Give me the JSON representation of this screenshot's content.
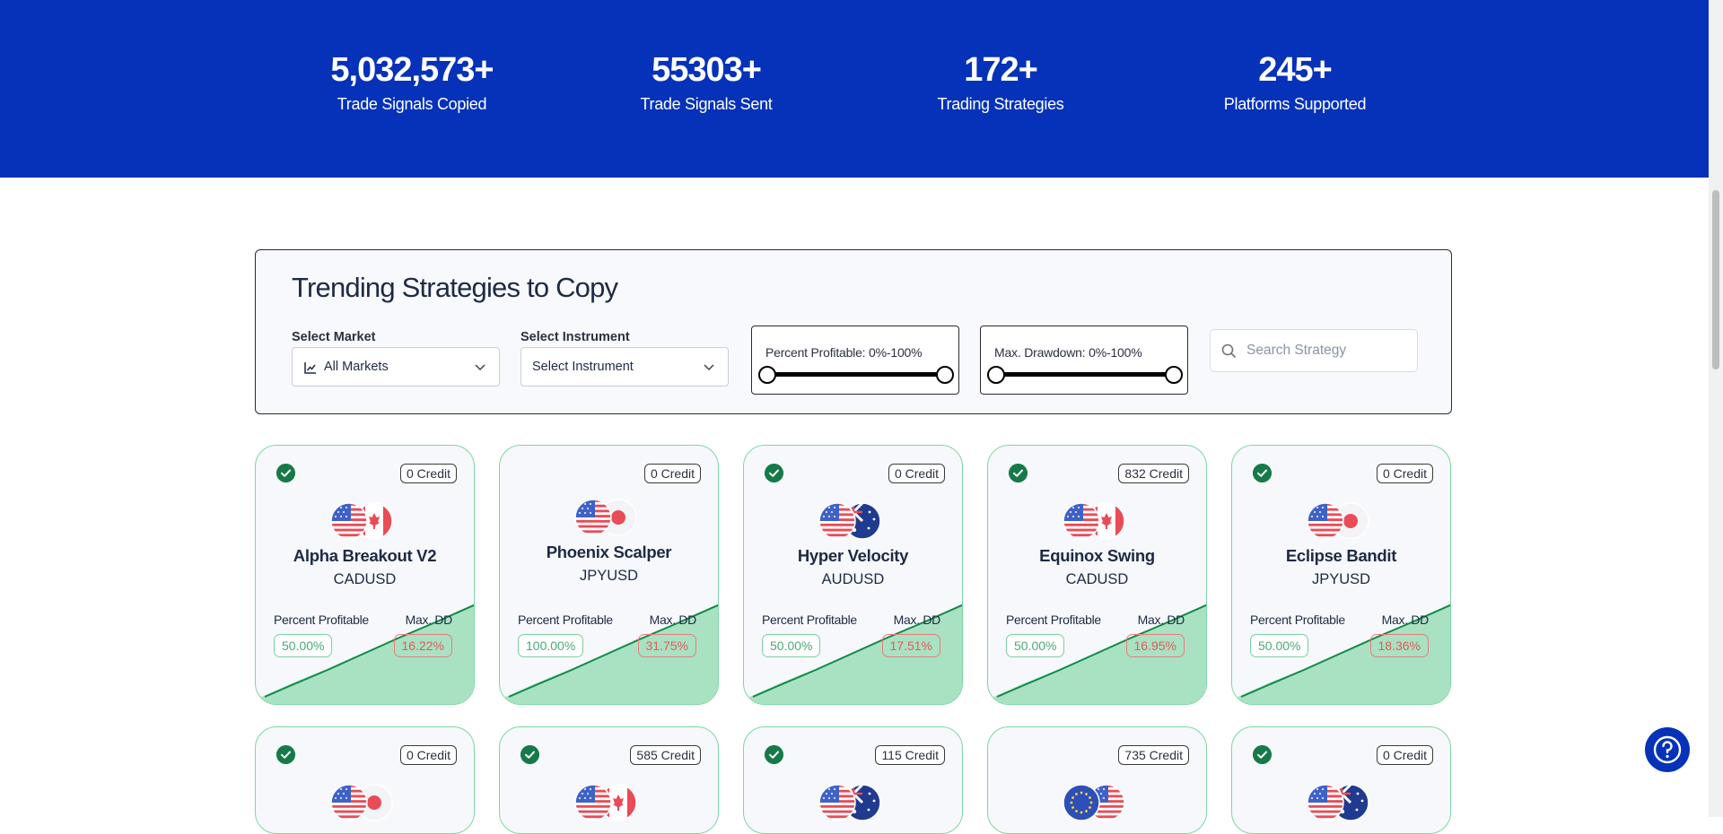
{
  "stats": [
    {
      "value": "5,032,573+",
      "label": "Trade Signals Copied"
    },
    {
      "value": "55303+",
      "label": "Trade Signals Sent"
    },
    {
      "value": "172+",
      "label": "Trading Strategies"
    },
    {
      "value": "245+",
      "label": "Platforms Supported"
    }
  ],
  "filters": {
    "title": "Trending Strategies to Copy",
    "market_label": "Select Market",
    "market_value": "All Markets",
    "instrument_label": "Select Instrument",
    "instrument_value": "Select Instrument",
    "profit_range": "Percent Profitable: 0%-100%",
    "drawdown_range": "Max. Drawdown: 0%-100%",
    "search_placeholder": "Search Strategy"
  },
  "card_labels": {
    "percent_profitable": "Percent Profitable",
    "max_dd": "Max. DD"
  },
  "cards": [
    {
      "name": "Alpha Breakout V2",
      "symbol": "CADUSD",
      "credit": "0 Credit",
      "verified": true,
      "profitable": "50.00%",
      "drawdown": "16.22%",
      "flags": [
        "us-flag",
        "canada-flag"
      ]
    },
    {
      "name": "Phoenix Scalper",
      "symbol": "JPYUSD",
      "credit": "0 Credit",
      "verified": false,
      "profitable": "100.00%",
      "drawdown": "31.75%",
      "flags": [
        "us-flag",
        "japan-flag"
      ]
    },
    {
      "name": "Hyper Velocity",
      "symbol": "AUDUSD",
      "credit": "0 Credit",
      "verified": true,
      "profitable": "50.00%",
      "drawdown": "17.51%",
      "flags": [
        "us-flag",
        "australia-flag"
      ]
    },
    {
      "name": "Equinox Swing",
      "symbol": "CADUSD",
      "credit": "832 Credit",
      "verified": true,
      "profitable": "50.00%",
      "drawdown": "16.95%",
      "flags": [
        "us-flag",
        "canada-flag"
      ]
    },
    {
      "name": "Eclipse Bandit",
      "symbol": "JPYUSD",
      "credit": "0 Credit",
      "verified": true,
      "profitable": "50.00%",
      "drawdown": "18.36%",
      "flags": [
        "us-flag",
        "japan-flag"
      ]
    },
    {
      "credit": "0 Credit",
      "verified": true,
      "flags": [
        "us-flag",
        "japan-flag"
      ]
    },
    {
      "credit": "585 Credit",
      "verified": true,
      "flags": [
        "us-flag",
        "canada-flag"
      ]
    },
    {
      "credit": "115 Credit",
      "verified": true,
      "flags": [
        "us-flag",
        "australia-flag"
      ]
    },
    {
      "credit": "735 Credit",
      "verified": false,
      "flags": [
        "eu-flag",
        "us-flag"
      ]
    },
    {
      "credit": "0 Credit",
      "verified": true,
      "flags": [
        "us-flag",
        "australia-flag"
      ]
    }
  ],
  "colors": {
    "brand": "#0532b8",
    "success": "#167a48",
    "danger": "#e25a5a",
    "chart_fill": "#a9e2c2"
  }
}
